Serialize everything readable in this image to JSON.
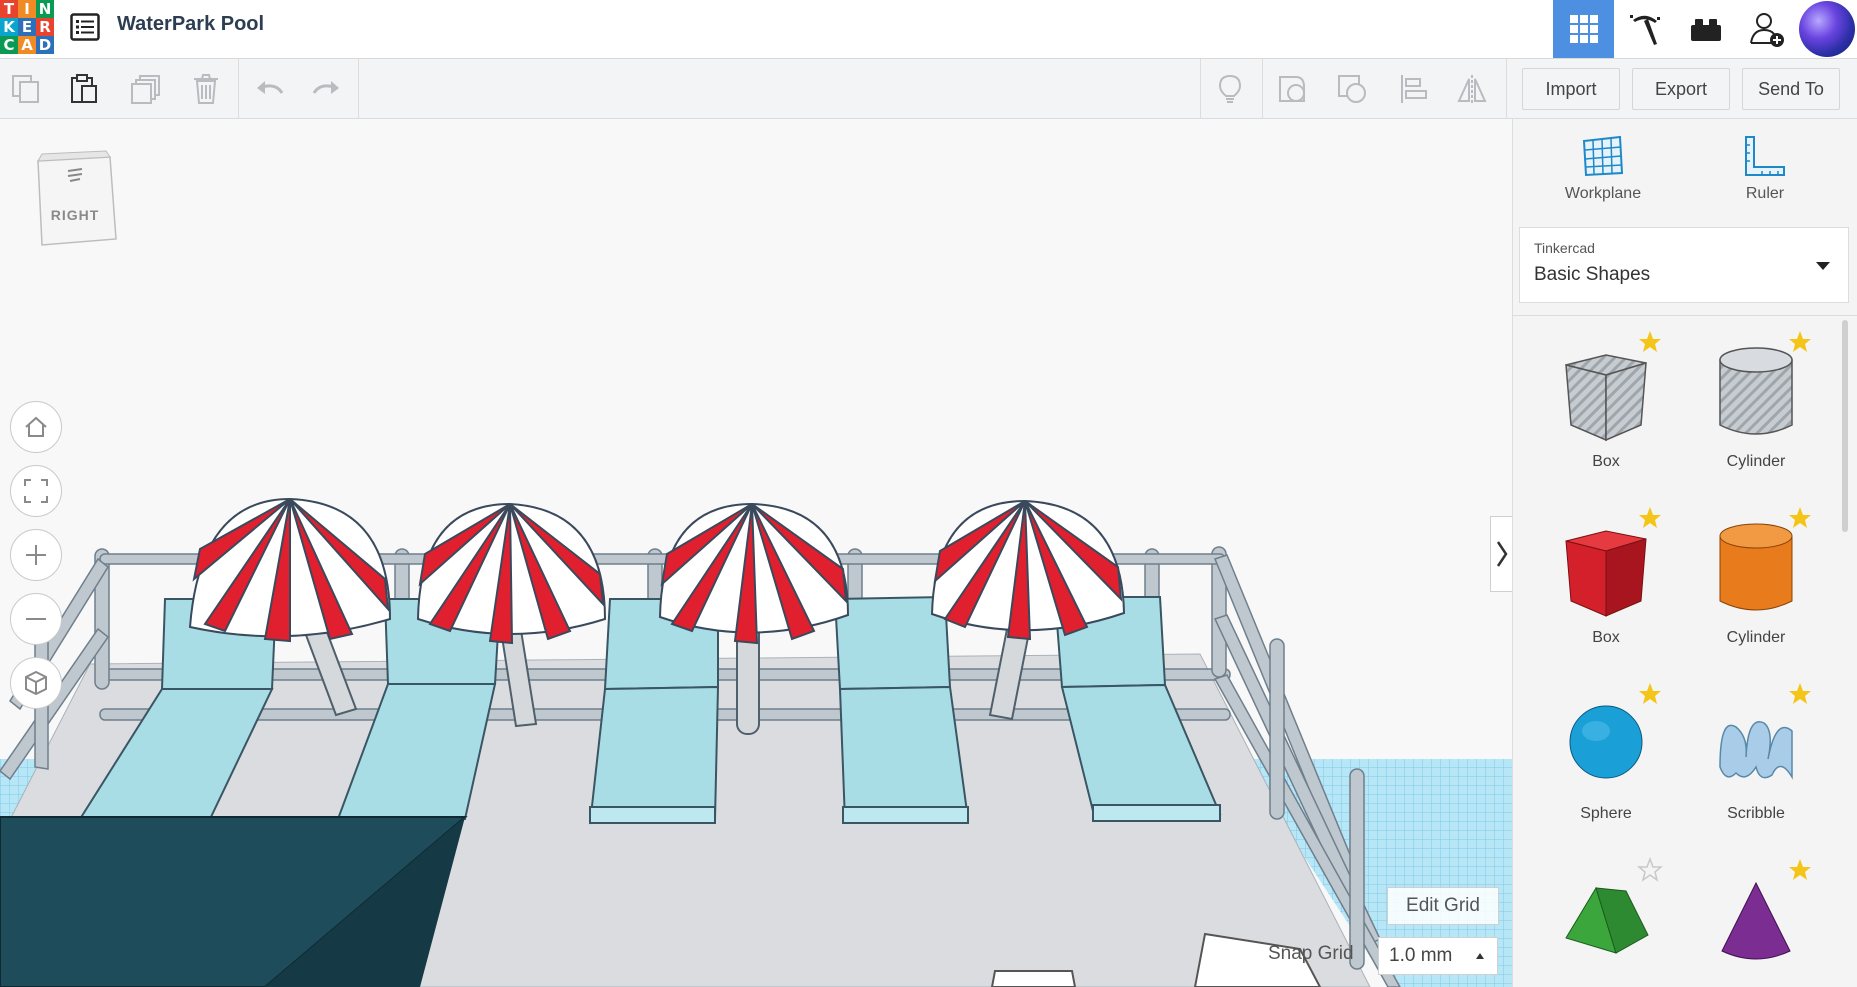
{
  "header": {
    "logo_letters": [
      "T",
      "I",
      "N",
      "K",
      "E",
      "R",
      "C",
      "A",
      "D"
    ],
    "logo_colors": [
      "#e8432f",
      "#f08a24",
      "#0a9a53",
      "#0aa5cc",
      "#2d6fb8",
      "#e8432f",
      "#0a9a53",
      "#f08a24",
      "#2d6fb8"
    ],
    "title": "WaterPark Pool"
  },
  "toolbar": {
    "import_label": "Import",
    "export_label": "Export",
    "sendto_label": "Send To"
  },
  "viewport": {
    "viewcube_label": "RIGHT",
    "edit_grid_label": "Edit Grid",
    "snap_grid_label": "Snap Grid",
    "snap_grid_value": "1.0 mm"
  },
  "panel": {
    "workplane_label": "Workplane",
    "ruler_label": "Ruler",
    "library_source": "Tinkercad",
    "library_name": "Basic Shapes",
    "shapes": [
      {
        "label": "Box",
        "kind": "box-hole",
        "starred": true
      },
      {
        "label": "Cylinder",
        "kind": "cylinder-hole",
        "starred": true
      },
      {
        "label": "Box",
        "kind": "box",
        "starred": true
      },
      {
        "label": "Cylinder",
        "kind": "cylinder",
        "starred": true
      },
      {
        "label": "Sphere",
        "kind": "sphere",
        "starred": true
      },
      {
        "label": "Scribble",
        "kind": "scribble",
        "starred": true
      },
      {
        "label": "",
        "kind": "roof",
        "starred": false
      },
      {
        "label": "",
        "kind": "cone",
        "starred": true
      }
    ]
  },
  "colors": {
    "accent": "#4d8fe1",
    "umbrella_red": "#e0202e",
    "lounger": "#a8dde6",
    "rail": "#b9c3cc",
    "deck": "#d9dcdf",
    "pool_grid": "#aee4f6",
    "box_red": "#d3202a",
    "cylinder_orange": "#e87b1c",
    "sphere_blue": "#1a9fd6",
    "roof_green": "#3aa63c",
    "cone_purple": "#7b2d92",
    "star": "#f4c518"
  }
}
